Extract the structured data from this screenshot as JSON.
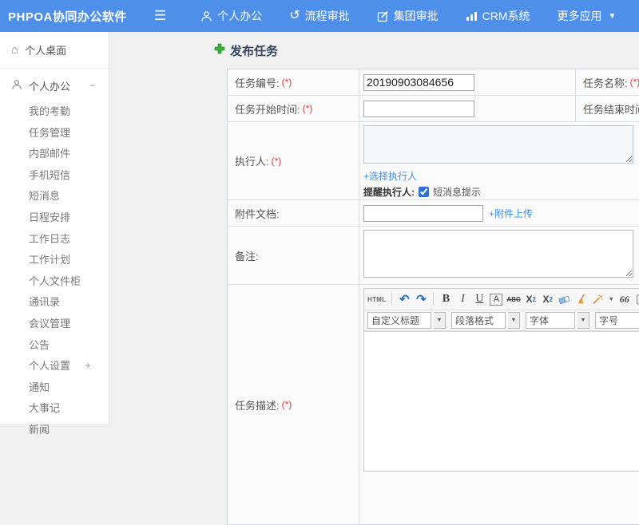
{
  "colors": {
    "header_bg": "#4d8fe9",
    "link_blue": "#3b8ded",
    "required_red": "#e0393e",
    "title_navy": "#33455e",
    "plus_green": "#3eb23e"
  },
  "header": {
    "logo": "PHPOA协同办公软件",
    "nav": [
      {
        "label": "个人办公"
      },
      {
        "label": "流程审批"
      },
      {
        "label": "集团审批"
      },
      {
        "label": "CRM系统"
      },
      {
        "label": "更多应用"
      }
    ]
  },
  "sidebar": {
    "desktop_label": "个人桌面",
    "group_label": "个人办公",
    "collapse_symbol": "−",
    "group_items": [
      "我的考勤",
      "任务管理",
      "内部邮件",
      "手机短信",
      "短消息",
      "日程安排",
      "工作日志",
      "工作计划",
      "个人文件柜",
      "通讯录",
      "会议管理",
      "公告"
    ],
    "settings_label": "个人设置",
    "expand_symbol": "+",
    "tail_items": [
      "通知",
      "大事记",
      "新闻"
    ]
  },
  "page": {
    "title": "发布任务"
  },
  "form": {
    "task_number": {
      "label": "任务编号:",
      "required": "(*)",
      "value": "20190903084656"
    },
    "task_name": {
      "label": "任务名称:",
      "required": "(*)"
    },
    "start_time": {
      "label": "任务开始时间:",
      "required": "(*)"
    },
    "end_time": {
      "label": "任务结束时间:",
      "required": "(*)"
    },
    "executor": {
      "label": "执行人:",
      "required": "(*)",
      "choose_link": "+选择执行人",
      "remind_label": "提醒执行人:",
      "sms_label": "短消息提示",
      "sms_checked": true
    },
    "attachment": {
      "label": "附件文档:",
      "upload_link": "+附件上传"
    },
    "remark": {
      "label": "备注:"
    },
    "description": {
      "label": "任务描述:",
      "required": "(*)"
    }
  },
  "editor": {
    "html_label": "HTML",
    "undo": "↶",
    "redo": "↷",
    "bold": "B",
    "italic": "I",
    "underline": "U",
    "font_box": "A",
    "strike": "ABC",
    "sup_base": "X",
    "sup_exp": "2",
    "sub_base": "X",
    "sub_exp": "2",
    "quote": "66",
    "color_letter": "A",
    "dropdowns": [
      "自定义标题",
      "段落格式",
      "字体",
      "字号"
    ]
  }
}
